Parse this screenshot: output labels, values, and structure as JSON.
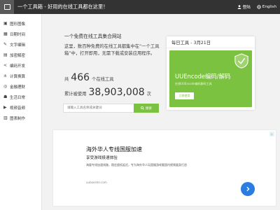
{
  "header": {
    "site_title": "一个工具箱 - 好用的在线工具都在这里！",
    "login_label": "登陆",
    "language_label": "English"
  },
  "sidebar": {
    "items": [
      {
        "label": "图形图像",
        "icon": "image-icon"
      },
      {
        "label": "日期时间",
        "icon": "calendar-icon"
      },
      {
        "label": "文字编辑",
        "icon": "text-icon"
      },
      {
        "label": "加密解密",
        "icon": "lock-icon"
      },
      {
        "label": "编码开发",
        "icon": "code-icon"
      },
      {
        "label": "计算换算",
        "icon": "calculator-icon"
      },
      {
        "label": "金融理财",
        "icon": "money-icon"
      },
      {
        "label": "生活日常",
        "icon": "life-icon"
      },
      {
        "label": "视频音频",
        "icon": "video-icon"
      },
      {
        "label": "图表制作",
        "icon": "chart-icon"
      }
    ]
  },
  "hero": {
    "welcome": "一个免费在线工具集合网站",
    "description": "这里，数百种免费的在线工具都集中在“一个工具箱”中，打开即用，无需下载或安装应用程序。",
    "tools_prefix": "共",
    "tools_count": "466",
    "tools_suffix": "个在线工具",
    "usage_prefix": "累计被使用",
    "usage_count": "38,903,008",
    "usage_suffix": "次"
  },
  "search": {
    "placeholder": "请输入工具名称或关键词",
    "button_label": "搜索"
  },
  "daily_card": {
    "header": "每日工具 - 3月21日",
    "title": "UUEncode编码/解码",
    "subtitle": "在线UUEncode编码解码工具",
    "button_label": "立即使用",
    "accent": "#7cc241"
  },
  "ad": {
    "title": "海外华人专线国服加速",
    "subtitle": "享受游戏极速体验",
    "description": "海量专线加速线路，稳定超低延迟，专为海外华人玩国服游戏看国内视频量身打造",
    "url": "uubooster.com"
  }
}
